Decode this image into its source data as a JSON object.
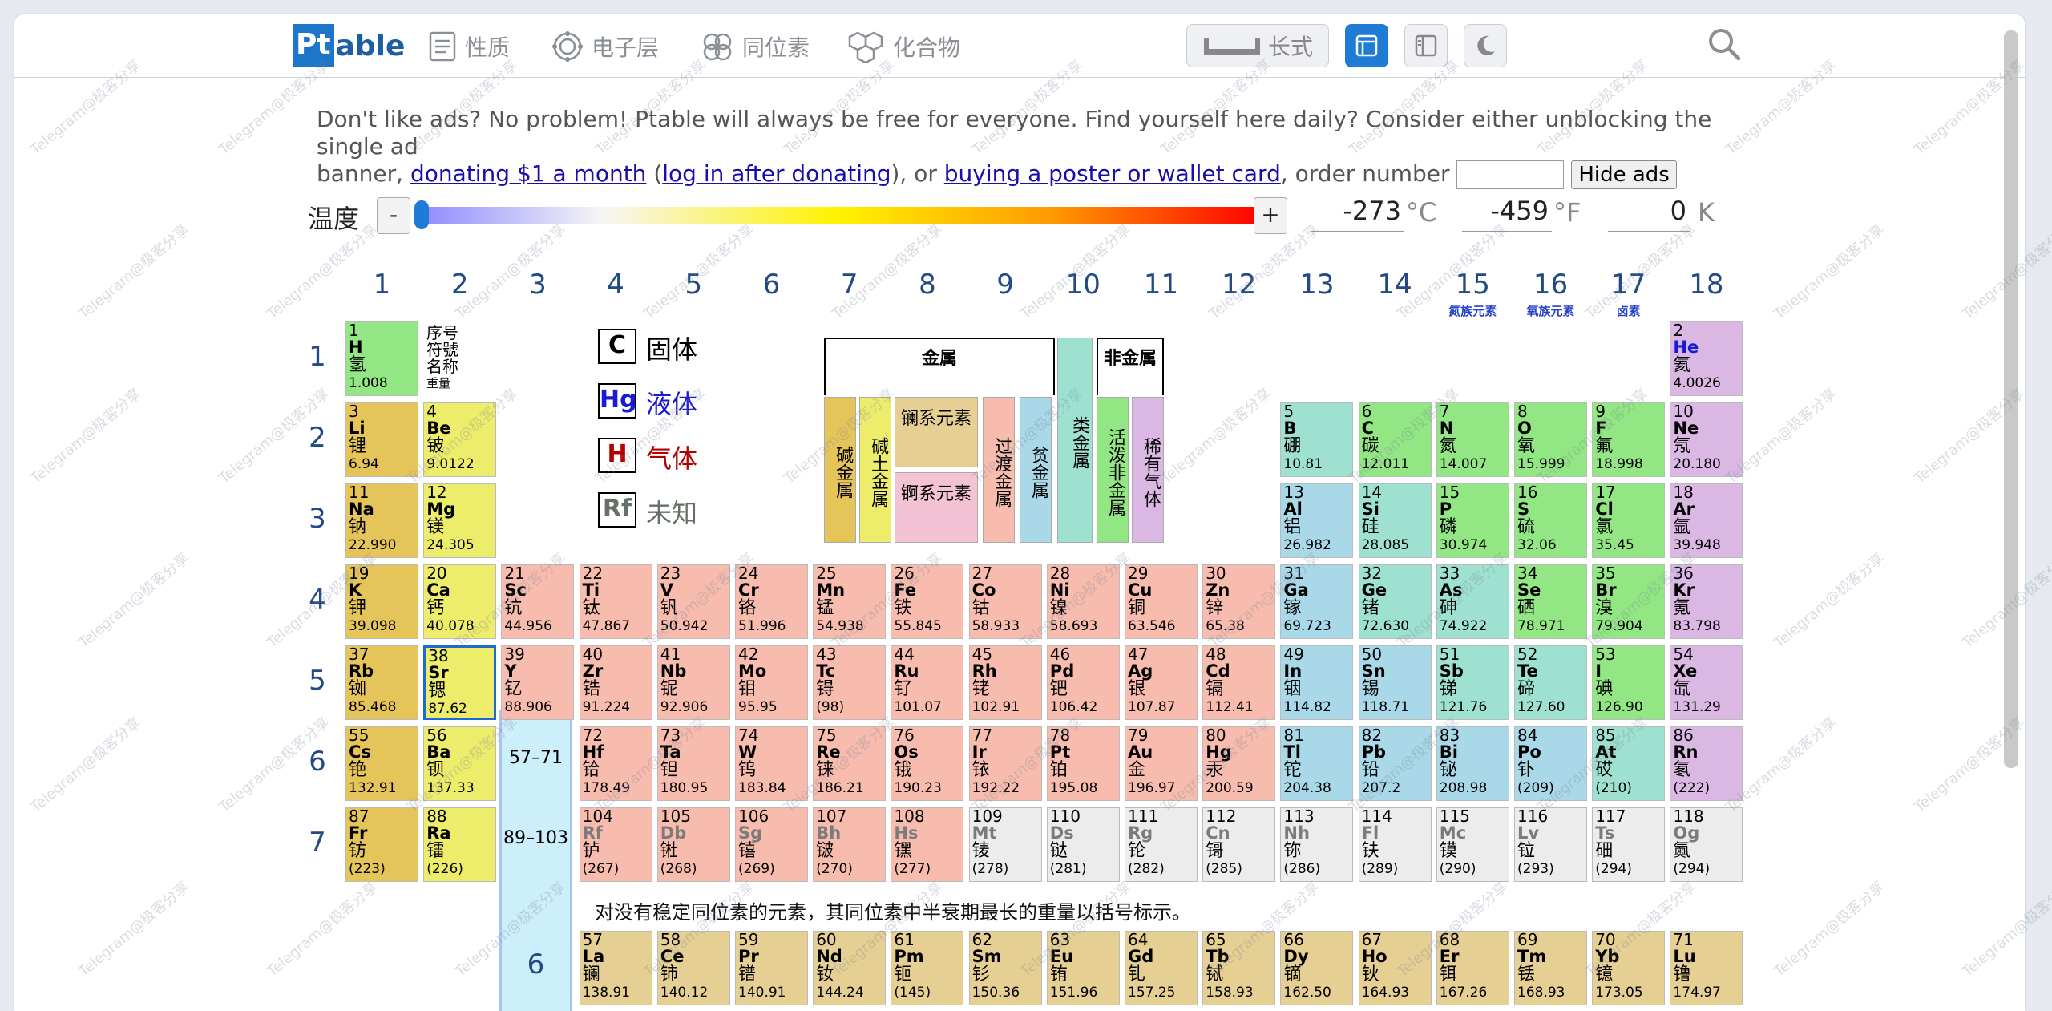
{
  "nav": {
    "logo_pt": "Pt",
    "logo_able": "able",
    "items": [
      "性质",
      "电子层",
      "同位素",
      "化合物"
    ],
    "layout_label": "长式"
  },
  "ad": {
    "line1": "Don't like ads? No problem! Ptable will always be free for everyone. Find yourself here daily? Consider either unblocking the single ad",
    "pre": "banner, ",
    "link1": "donating $1 a month",
    "mid1": " (",
    "link2": "log in after donating",
    "mid2": "), or ",
    "link3": "buying a poster or wallet card",
    "post": ", order number",
    "hide_label": "Hide ads"
  },
  "temp": {
    "label": "温度",
    "minus": "-",
    "plus": "+",
    "celsius": "-273",
    "c_unit": "°C",
    "fahrenheit": "-459",
    "f_unit": "°F",
    "kelvin": "0",
    "k_unit": "K",
    "slider_fraction": 0.0
  },
  "groups": [
    "1",
    "2",
    "3",
    "4",
    "5",
    "6",
    "7",
    "8",
    "9",
    "10",
    "11",
    "12",
    "13",
    "14",
    "15",
    "16",
    "17",
    "18"
  ],
  "group_names": {
    "15": "氮族元素",
    "16": "氧族元素",
    "17": "卤素"
  },
  "periods": [
    "1",
    "2",
    "3",
    "4",
    "5",
    "6",
    "7"
  ],
  "key": [
    "序号",
    "符號",
    "名称",
    "重量"
  ],
  "legend": [
    {
      "sym": "C",
      "label": "固体",
      "color": "#000000"
    },
    {
      "sym": "Hg",
      "label": "液体",
      "color": "#1a1ad6"
    },
    {
      "sym": "H",
      "label": "气体",
      "color": "#b40000"
    },
    {
      "sym": "Rf",
      "label": "未知",
      "color": "#667066"
    }
  ],
  "categories": {
    "metal_header": "金属",
    "nonmetal_header": "非金属",
    "alkali": "碱金属",
    "alkaline": "碱土金属",
    "lanthanides": "镧系元素",
    "actinides": "锕系元素",
    "transition": "过渡金属",
    "poor": "贫金属",
    "metalloid": "类金属",
    "reactive": "活泼非金属",
    "noble": "稀有气体"
  },
  "range_labels": {
    "la": "57–71",
    "ac": "89–103",
    "lan_row": "6"
  },
  "note": "对没有稳定同位素的元素，其同位素中半衰期最长的重量以括号标示。",
  "colors": {
    "alkali": "#e5c55a",
    "alkaline": "#eded6b",
    "transition": "#f7bcae",
    "poor": "#a9d8e8",
    "metalloid": "#9ee1d0",
    "nonmetal": "#92e683",
    "noble": "#dab8e3",
    "lanthanide": "#e6cf93",
    "actinide": "#f3c2d4",
    "unknown": "#ececec",
    "accent": "#1e7bd6"
  },
  "elements": [
    {
      "n": "1",
      "s": "H",
      "c": "氢",
      "m": "1.008",
      "g": 1,
      "p": 1,
      "t": "nonmetal"
    },
    {
      "n": "2",
      "s": "He",
      "c": "氦",
      "m": "4.0026",
      "g": 18,
      "p": 1,
      "t": "noble",
      "state": "blue"
    },
    {
      "n": "3",
      "s": "Li",
      "c": "锂",
      "m": "6.94",
      "g": 1,
      "p": 2,
      "t": "alkali"
    },
    {
      "n": "4",
      "s": "Be",
      "c": "铍",
      "m": "9.0122",
      "g": 2,
      "p": 2,
      "t": "alkaline"
    },
    {
      "n": "5",
      "s": "B",
      "c": "硼",
      "m": "10.81",
      "g": 13,
      "p": 2,
      "t": "metalloid"
    },
    {
      "n": "6",
      "s": "C",
      "c": "碳",
      "m": "12.011",
      "g": 14,
      "p": 2,
      "t": "nonmetal"
    },
    {
      "n": "7",
      "s": "N",
      "c": "氮",
      "m": "14.007",
      "g": 15,
      "p": 2,
      "t": "nonmetal"
    },
    {
      "n": "8",
      "s": "O",
      "c": "氧",
      "m": "15.999",
      "g": 16,
      "p": 2,
      "t": "nonmetal"
    },
    {
      "n": "9",
      "s": "F",
      "c": "氟",
      "m": "18.998",
      "g": 17,
      "p": 2,
      "t": "nonmetal"
    },
    {
      "n": "10",
      "s": "Ne",
      "c": "氖",
      "m": "20.180",
      "g": 18,
      "p": 2,
      "t": "noble"
    },
    {
      "n": "11",
      "s": "Na",
      "c": "钠",
      "m": "22.990",
      "g": 1,
      "p": 3,
      "t": "alkali"
    },
    {
      "n": "12",
      "s": "Mg",
      "c": "镁",
      "m": "24.305",
      "g": 2,
      "p": 3,
      "t": "alkaline"
    },
    {
      "n": "13",
      "s": "Al",
      "c": "铝",
      "m": "26.982",
      "g": 13,
      "p": 3,
      "t": "poor"
    },
    {
      "n": "14",
      "s": "Si",
      "c": "硅",
      "m": "28.085",
      "g": 14,
      "p": 3,
      "t": "metalloid"
    },
    {
      "n": "15",
      "s": "P",
      "c": "磷",
      "m": "30.974",
      "g": 15,
      "p": 3,
      "t": "nonmetal"
    },
    {
      "n": "16",
      "s": "S",
      "c": "硫",
      "m": "32.06",
      "g": 16,
      "p": 3,
      "t": "nonmetal"
    },
    {
      "n": "17",
      "s": "Cl",
      "c": "氯",
      "m": "35.45",
      "g": 17,
      "p": 3,
      "t": "nonmetal"
    },
    {
      "n": "18",
      "s": "Ar",
      "c": "氩",
      "m": "39.948",
      "g": 18,
      "p": 3,
      "t": "noble"
    },
    {
      "n": "19",
      "s": "K",
      "c": "钾",
      "m": "39.098",
      "g": 1,
      "p": 4,
      "t": "alkali"
    },
    {
      "n": "20",
      "s": "Ca",
      "c": "钙",
      "m": "40.078",
      "g": 2,
      "p": 4,
      "t": "alkaline"
    },
    {
      "n": "21",
      "s": "Sc",
      "c": "钪",
      "m": "44.956",
      "g": 3,
      "p": 4,
      "t": "transition"
    },
    {
      "n": "22",
      "s": "Ti",
      "c": "钛",
      "m": "47.867",
      "g": 4,
      "p": 4,
      "t": "transition"
    },
    {
      "n": "23",
      "s": "V",
      "c": "钒",
      "m": "50.942",
      "g": 5,
      "p": 4,
      "t": "transition"
    },
    {
      "n": "24",
      "s": "Cr",
      "c": "铬",
      "m": "51.996",
      "g": 6,
      "p": 4,
      "t": "transition"
    },
    {
      "n": "25",
      "s": "Mn",
      "c": "锰",
      "m": "54.938",
      "g": 7,
      "p": 4,
      "t": "transition"
    },
    {
      "n": "26",
      "s": "Fe",
      "c": "铁",
      "m": "55.845",
      "g": 8,
      "p": 4,
      "t": "transition"
    },
    {
      "n": "27",
      "s": "Co",
      "c": "钴",
      "m": "58.933",
      "g": 9,
      "p": 4,
      "t": "transition"
    },
    {
      "n": "28",
      "s": "Ni",
      "c": "镍",
      "m": "58.693",
      "g": 10,
      "p": 4,
      "t": "transition"
    },
    {
      "n": "29",
      "s": "Cu",
      "c": "铜",
      "m": "63.546",
      "g": 11,
      "p": 4,
      "t": "transition"
    },
    {
      "n": "30",
      "s": "Zn",
      "c": "锌",
      "m": "65.38",
      "g": 12,
      "p": 4,
      "t": "transition"
    },
    {
      "n": "31",
      "s": "Ga",
      "c": "镓",
      "m": "69.723",
      "g": 13,
      "p": 4,
      "t": "poor"
    },
    {
      "n": "32",
      "s": "Ge",
      "c": "锗",
      "m": "72.630",
      "g": 14,
      "p": 4,
      "t": "metalloid"
    },
    {
      "n": "33",
      "s": "As",
      "c": "砷",
      "m": "74.922",
      "g": 15,
      "p": 4,
      "t": "metalloid"
    },
    {
      "n": "34",
      "s": "Se",
      "c": "硒",
      "m": "78.971",
      "g": 16,
      "p": 4,
      "t": "nonmetal"
    },
    {
      "n": "35",
      "s": "Br",
      "c": "溴",
      "m": "79.904",
      "g": 17,
      "p": 4,
      "t": "nonmetal"
    },
    {
      "n": "36",
      "s": "Kr",
      "c": "氪",
      "m": "83.798",
      "g": 18,
      "p": 4,
      "t": "noble"
    },
    {
      "n": "37",
      "s": "Rb",
      "c": "铷",
      "m": "85.468",
      "g": 1,
      "p": 5,
      "t": "alkali"
    },
    {
      "n": "38",
      "s": "Sr",
      "c": "锶",
      "m": "87.62",
      "g": 2,
      "p": 5,
      "t": "alkaline",
      "sel": true
    },
    {
      "n": "39",
      "s": "Y",
      "c": "钇",
      "m": "88.906",
      "g": 3,
      "p": 5,
      "t": "transition"
    },
    {
      "n": "40",
      "s": "Zr",
      "c": "锆",
      "m": "91.224",
      "g": 4,
      "p": 5,
      "t": "transition"
    },
    {
      "n": "41",
      "s": "Nb",
      "c": "铌",
      "m": "92.906",
      "g": 5,
      "p": 5,
      "t": "transition"
    },
    {
      "n": "42",
      "s": "Mo",
      "c": "钼",
      "m": "95.95",
      "g": 6,
      "p": 5,
      "t": "transition"
    },
    {
      "n": "43",
      "s": "Tc",
      "c": "锝",
      "m": "(98)",
      "g": 7,
      "p": 5,
      "t": "transition"
    },
    {
      "n": "44",
      "s": "Ru",
      "c": "钌",
      "m": "101.07",
      "g": 8,
      "p": 5,
      "t": "transition"
    },
    {
      "n": "45",
      "s": "Rh",
      "c": "铑",
      "m": "102.91",
      "g": 9,
      "p": 5,
      "t": "transition"
    },
    {
      "n": "46",
      "s": "Pd",
      "c": "钯",
      "m": "106.42",
      "g": 10,
      "p": 5,
      "t": "transition"
    },
    {
      "n": "47",
      "s": "Ag",
      "c": "银",
      "m": "107.87",
      "g": 11,
      "p": 5,
      "t": "transition"
    },
    {
      "n": "48",
      "s": "Cd",
      "c": "镉",
      "m": "112.41",
      "g": 12,
      "p": 5,
      "t": "transition"
    },
    {
      "n": "49",
      "s": "In",
      "c": "铟",
      "m": "114.82",
      "g": 13,
      "p": 5,
      "t": "poor"
    },
    {
      "n": "50",
      "s": "Sn",
      "c": "锡",
      "m": "118.71",
      "g": 14,
      "p": 5,
      "t": "poor"
    },
    {
      "n": "51",
      "s": "Sb",
      "c": "锑",
      "m": "121.76",
      "g": 15,
      "p": 5,
      "t": "metalloid"
    },
    {
      "n": "52",
      "s": "Te",
      "c": "碲",
      "m": "127.60",
      "g": 16,
      "p": 5,
      "t": "metalloid"
    },
    {
      "n": "53",
      "s": "I",
      "c": "碘",
      "m": "126.90",
      "g": 17,
      "p": 5,
      "t": "nonmetal"
    },
    {
      "n": "54",
      "s": "Xe",
      "c": "氙",
      "m": "131.29",
      "g": 18,
      "p": 5,
      "t": "noble"
    },
    {
      "n": "55",
      "s": "Cs",
      "c": "铯",
      "m": "132.91",
      "g": 1,
      "p": 6,
      "t": "alkali"
    },
    {
      "n": "56",
      "s": "Ba",
      "c": "钡",
      "m": "137.33",
      "g": 2,
      "p": 6,
      "t": "alkaline"
    },
    {
      "n": "72",
      "s": "Hf",
      "c": "铪",
      "m": "178.49",
      "g": 4,
      "p": 6,
      "t": "transition"
    },
    {
      "n": "73",
      "s": "Ta",
      "c": "钽",
      "m": "180.95",
      "g": 5,
      "p": 6,
      "t": "transition"
    },
    {
      "n": "74",
      "s": "W",
      "c": "钨",
      "m": "183.84",
      "g": 6,
      "p": 6,
      "t": "transition"
    },
    {
      "n": "75",
      "s": "Re",
      "c": "铼",
      "m": "186.21",
      "g": 7,
      "p": 6,
      "t": "transition"
    },
    {
      "n": "76",
      "s": "Os",
      "c": "锇",
      "m": "190.23",
      "g": 8,
      "p": 6,
      "t": "transition"
    },
    {
      "n": "77",
      "s": "Ir",
      "c": "铱",
      "m": "192.22",
      "g": 9,
      "p": 6,
      "t": "transition"
    },
    {
      "n": "78",
      "s": "Pt",
      "c": "铂",
      "m": "195.08",
      "g": 10,
      "p": 6,
      "t": "transition"
    },
    {
      "n": "79",
      "s": "Au",
      "c": "金",
      "m": "196.97",
      "g": 11,
      "p": 6,
      "t": "transition"
    },
    {
      "n": "80",
      "s": "Hg",
      "c": "汞",
      "m": "200.59",
      "g": 12,
      "p": 6,
      "t": "transition"
    },
    {
      "n": "81",
      "s": "Tl",
      "c": "铊",
      "m": "204.38",
      "g": 13,
      "p": 6,
      "t": "poor"
    },
    {
      "n": "82",
      "s": "Pb",
      "c": "铅",
      "m": "207.2",
      "g": 14,
      "p": 6,
      "t": "poor"
    },
    {
      "n": "83",
      "s": "Bi",
      "c": "铋",
      "m": "208.98",
      "g": 15,
      "p": 6,
      "t": "poor"
    },
    {
      "n": "84",
      "s": "Po",
      "c": "钋",
      "m": "(209)",
      "g": 16,
      "p": 6,
      "t": "poor"
    },
    {
      "n": "85",
      "s": "At",
      "c": "砹",
      "m": "(210)",
      "g": 17,
      "p": 6,
      "t": "metalloid"
    },
    {
      "n": "86",
      "s": "Rn",
      "c": "氡",
      "m": "(222)",
      "g": 18,
      "p": 6,
      "t": "noble"
    },
    {
      "n": "87",
      "s": "Fr",
      "c": "钫",
      "m": "(223)",
      "g": 1,
      "p": 7,
      "t": "alkali"
    },
    {
      "n": "88",
      "s": "Ra",
      "c": "镭",
      "m": "(226)",
      "g": 2,
      "p": 7,
      "t": "alkaline"
    },
    {
      "n": "104",
      "s": "Rf",
      "c": "𬬻",
      "m": "(267)",
      "g": 4,
      "p": 7,
      "t": "transition",
      "state": "gray"
    },
    {
      "n": "105",
      "s": "Db",
      "c": "𬭊",
      "m": "(268)",
      "g": 5,
      "p": 7,
      "t": "transition",
      "state": "gray"
    },
    {
      "n": "106",
      "s": "Sg",
      "c": "𬭳",
      "m": "(269)",
      "g": 6,
      "p": 7,
      "t": "transition",
      "state": "gray"
    },
    {
      "n": "107",
      "s": "Bh",
      "c": "𬭛",
      "m": "(270)",
      "g": 7,
      "p": 7,
      "t": "transition",
      "state": "gray"
    },
    {
      "n": "108",
      "s": "Hs",
      "c": "𬭶",
      "m": "(277)",
      "g": 8,
      "p": 7,
      "t": "transition",
      "state": "gray"
    },
    {
      "n": "109",
      "s": "Mt",
      "c": "鿏",
      "m": "(278)",
      "g": 9,
      "p": 7,
      "t": "unknown",
      "state": "gray"
    },
    {
      "n": "110",
      "s": "Ds",
      "c": "𫟼",
      "m": "(281)",
      "g": 10,
      "p": 7,
      "t": "unknown",
      "state": "gray"
    },
    {
      "n": "111",
      "s": "Rg",
      "c": "𬬭",
      "m": "(282)",
      "g": 11,
      "p": 7,
      "t": "unknown",
      "state": "gray"
    },
    {
      "n": "112",
      "s": "Cn",
      "c": "鿔",
      "m": "(285)",
      "g": 12,
      "p": 7,
      "t": "unknown",
      "state": "gray"
    },
    {
      "n": "113",
      "s": "Nh",
      "c": "鿭",
      "m": "(286)",
      "g": 13,
      "p": 7,
      "t": "unknown",
      "state": "gray"
    },
    {
      "n": "114",
      "s": "Fl",
      "c": "𫓧",
      "m": "(289)",
      "g": 14,
      "p": 7,
      "t": "unknown",
      "state": "gray"
    },
    {
      "n": "115",
      "s": "Mc",
      "c": "镆",
      "m": "(290)",
      "g": 15,
      "p": 7,
      "t": "unknown",
      "state": "gray"
    },
    {
      "n": "116",
      "s": "Lv",
      "c": "𫟷",
      "m": "(293)",
      "g": 16,
      "p": 7,
      "t": "unknown",
      "state": "gray"
    },
    {
      "n": "117",
      "s": "Ts",
      "c": "鿬",
      "m": "(294)",
      "g": 17,
      "p": 7,
      "t": "unknown",
      "state": "gray"
    },
    {
      "n": "118",
      "s": "Og",
      "c": "鿫",
      "m": "(294)",
      "g": 18,
      "p": 7,
      "t": "unknown",
      "state": "gray"
    }
  ],
  "lanthanides": [
    {
      "n": "57",
      "s": "La",
      "c": "镧",
      "m": "138.91"
    },
    {
      "n": "58",
      "s": "Ce",
      "c": "铈",
      "m": "140.12"
    },
    {
      "n": "59",
      "s": "Pr",
      "c": "镨",
      "m": "140.91"
    },
    {
      "n": "60",
      "s": "Nd",
      "c": "钕",
      "m": "144.24"
    },
    {
      "n": "61",
      "s": "Pm",
      "c": "钷",
      "m": "(145)"
    },
    {
      "n": "62",
      "s": "Sm",
      "c": "钐",
      "m": "150.36"
    },
    {
      "n": "63",
      "s": "Eu",
      "c": "铕",
      "m": "151.96"
    },
    {
      "n": "64",
      "s": "Gd",
      "c": "钆",
      "m": "157.25"
    },
    {
      "n": "65",
      "s": "Tb",
      "c": "铽",
      "m": "158.93"
    },
    {
      "n": "66",
      "s": "Dy",
      "c": "镝",
      "m": "162.50"
    },
    {
      "n": "67",
      "s": "Ho",
      "c": "钬",
      "m": "164.93"
    },
    {
      "n": "68",
      "s": "Er",
      "c": "铒",
      "m": "167.26"
    },
    {
      "n": "69",
      "s": "Tm",
      "c": "铥",
      "m": "168.93"
    },
    {
      "n": "70",
      "s": "Yb",
      "c": "镱",
      "m": "173.05"
    },
    {
      "n": "71",
      "s": "Lu",
      "c": "镥",
      "m": "174.97"
    }
  ],
  "watermark": "Telegram@极客分享"
}
